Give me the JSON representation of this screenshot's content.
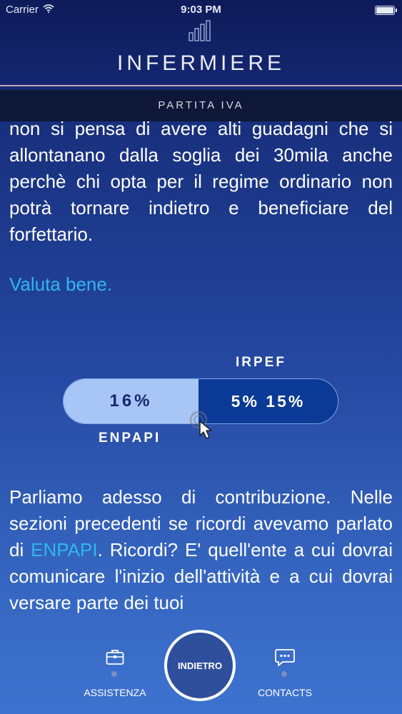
{
  "status_bar": {
    "carrier": "Carrier",
    "time": "9:03 PM"
  },
  "header": {
    "title": "INFERMIERE",
    "logo_icon": "bar-chart-icon",
    "subtitle": "PARTITA IVA"
  },
  "content": {
    "paragraph_top": "non si pensa di avere alti guadagni che si allontanano dalla soglia dei 30mila anche perchè chi opta per il regime ordinario non potrà tornare indietro e beneficiare del forfettario.",
    "highlight": "Valuta bene.",
    "paragraph_bottom": {
      "before_link": "Parliamo adesso di contribuzione. Nelle sezioni precedenti se ricordi avevamo parlato di ",
      "link": "ENPAPI",
      "after_link": ". Ricordi? E' quell'ente a cui dovrai comunicare l'inizio dell'attività e a cui dovrai versare parte dei tuoi"
    }
  },
  "tax_bar": {
    "label_top": "IRPEF",
    "label_bottom": "ENPAPI",
    "enpapi_value": "16%",
    "irpef_value": "5% 15%"
  },
  "bottom_nav": {
    "left_label": "ASSISTENZA",
    "left_icon": "briefcase-icon",
    "center_label": "INDIETRO",
    "right_label": "CONTACTS",
    "right_icon": "chat-bubble-icon"
  },
  "colors": {
    "background_top": "#0f1f63",
    "background_bottom": "#3d73cf",
    "link": "#31b6ef",
    "enpapi_segment": "#a7c6f6",
    "irpef_segment": "#0b3a96"
  }
}
